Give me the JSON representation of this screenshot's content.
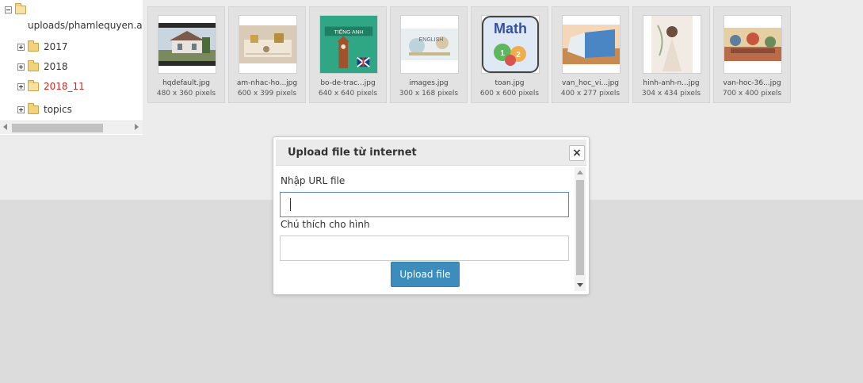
{
  "tree": {
    "root_path": "uploads/phamlequyen.azte",
    "folders": [
      {
        "label": "2017",
        "active": false
      },
      {
        "label": "2018",
        "active": false
      },
      {
        "label": "2018_11",
        "active": true
      },
      {
        "label": "topics",
        "active": false
      }
    ]
  },
  "thumbnails": [
    {
      "name": "hqdefault.jpg",
      "dims": "480 x 360 pixels",
      "icon": "house-photo"
    },
    {
      "name": "am-nhac-ho...jpg",
      "dims": "600 x 399 pixels",
      "icon": "music-photo"
    },
    {
      "name": "bo-de-trac...jpg",
      "dims": "640 x 640 pixels",
      "icon": "book-cover",
      "cover_text": "TIẾNG ANH"
    },
    {
      "name": "images.jpg",
      "dims": "300 x 168 pixels",
      "icon": "english-banner",
      "cover_text": "ENGLISH"
    },
    {
      "name": "toan.jpg",
      "dims": "600 x 600 pixels",
      "icon": "math-logo",
      "cover_text": "Math"
    },
    {
      "name": "van_hoc_vi...jpg",
      "dims": "400 x 277 pixels",
      "icon": "book-photo"
    },
    {
      "name": "hinh-anh-n...jpg",
      "dims": "304 x 434 pixels",
      "icon": "portrait-photo"
    },
    {
      "name": "van-hoc-36...jpg",
      "dims": "700 x 400 pixels",
      "icon": "painting-photo"
    }
  ],
  "dialog": {
    "title": "Upload file từ internet",
    "close_symbol": "×",
    "url_label": "Nhập URL file",
    "url_value": "",
    "caption_label": "Chú thích cho hình",
    "caption_value": "",
    "upload_label": "Upload file"
  },
  "colors": {
    "accent": "#3c8dbc",
    "active_folder": "#d9261c"
  }
}
